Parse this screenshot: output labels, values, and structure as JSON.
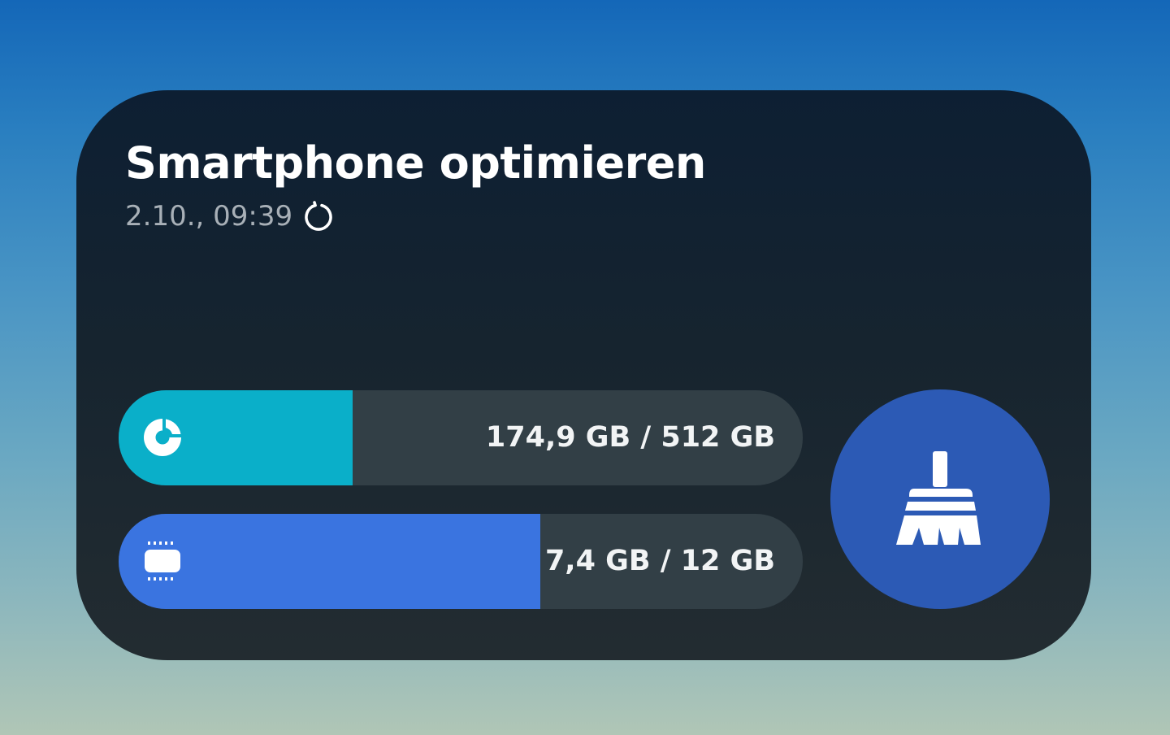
{
  "widget": {
    "title": "Smartphone optimieren",
    "timestamp": "2.10., 09:39",
    "refresh_icon": "refresh-icon"
  },
  "storage": {
    "icon": "storage-pie-icon",
    "label": "174,9 GB / 512 GB",
    "used_gb": 174.9,
    "total_gb": 512,
    "color": "#0aafc9"
  },
  "ram": {
    "icon": "memory-chip-icon",
    "label": "7,4 GB / 12 GB",
    "used_gb": 7.4,
    "total_gb": 12,
    "color": "#3a74e0"
  },
  "clean_button": {
    "icon": "broom-icon",
    "color": "#2c5ab5"
  },
  "colors": {
    "card_background": "#16242f",
    "track": "#323f46"
  }
}
